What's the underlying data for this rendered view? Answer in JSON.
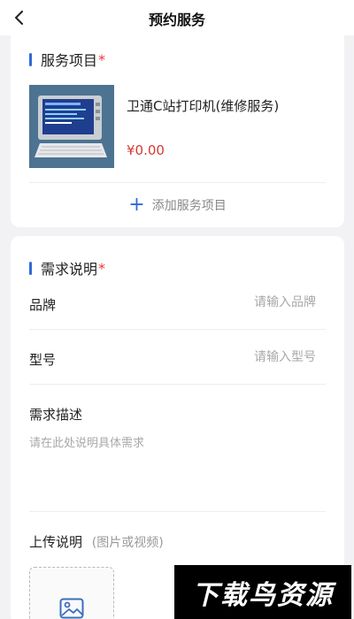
{
  "header": {
    "title": "预约服务"
  },
  "service_section": {
    "title": "服务项目",
    "required_mark": "*",
    "product": {
      "name": "卫通C站打印机(维修服务)",
      "price": "¥0.00"
    },
    "add_label": "添加服务项目"
  },
  "requirement_section": {
    "title": "需求说明",
    "required_mark": "*",
    "brand": {
      "label": "品牌",
      "placeholder": "请输入品牌",
      "value": ""
    },
    "model": {
      "label": "型号",
      "placeholder": "请输入型号",
      "value": ""
    },
    "description": {
      "label": "需求描述",
      "placeholder": "请在此处说明具体需求",
      "value": ""
    },
    "upload": {
      "label": "上传说明",
      "hint": "(图片或视频)"
    }
  },
  "watermark": {
    "text": "下载鸟资源"
  },
  "colors": {
    "accent": "#2f6bd8",
    "required": "#e8383d",
    "price": "#d23b34",
    "background": "#f2f2f4"
  },
  "icons": {
    "back": "chevron-left-icon",
    "add": "plus-icon",
    "upload": "image-icon"
  }
}
